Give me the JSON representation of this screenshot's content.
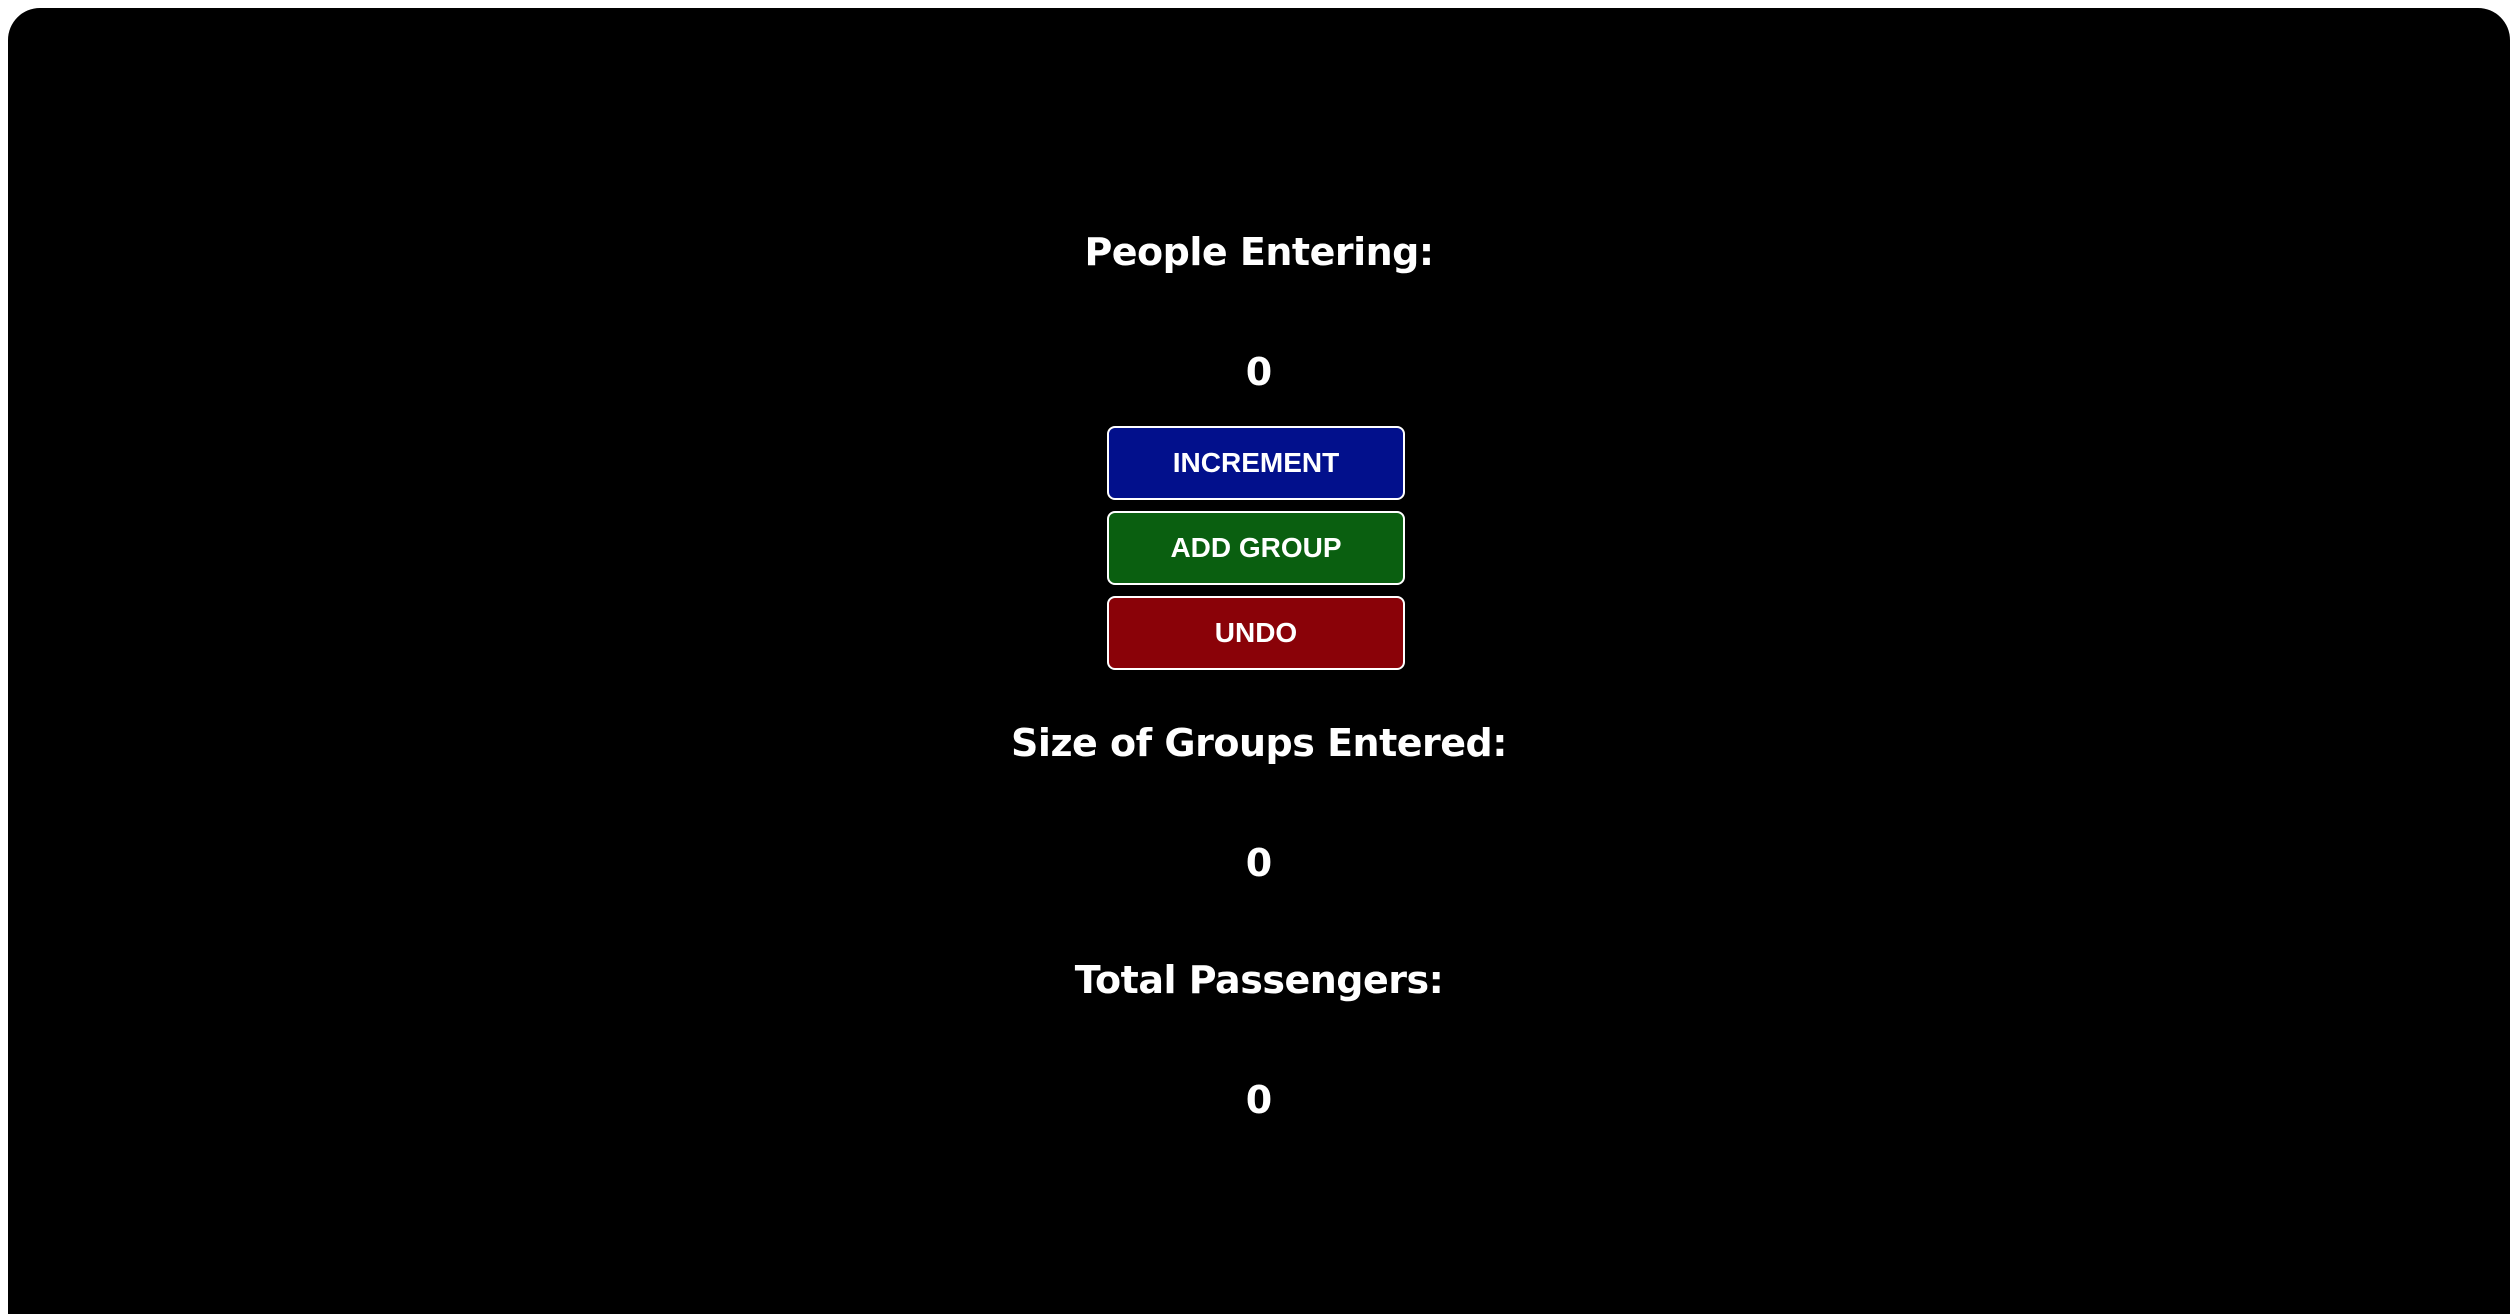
{
  "people_entering": {
    "label": "People Entering:",
    "value": "0"
  },
  "buttons": {
    "increment_label": "INCREMENT",
    "add_group_label": "ADD GROUP",
    "undo_label": "UNDO"
  },
  "groups_entered": {
    "label": "Size of Groups Entered:",
    "value": "0"
  },
  "total_passengers": {
    "label": "Total Passengers:",
    "value": "0"
  },
  "colors": {
    "background": "#000000",
    "increment": "#02108c",
    "add_group": "#0a5f10",
    "undo": "#8a0208",
    "text": "#ffffff"
  }
}
